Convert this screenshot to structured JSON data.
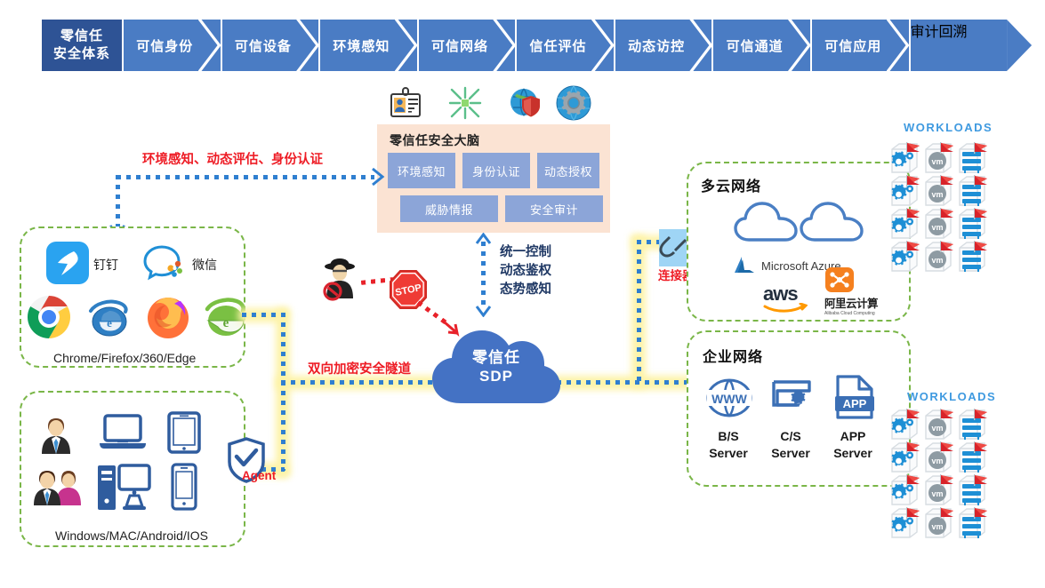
{
  "header": {
    "first_block": {
      "line1": "零信任",
      "line2": "安全体系"
    },
    "stages": [
      "可信身份",
      "可信设备",
      "环境感知",
      "可信网络",
      "信任评估",
      "动态访控",
      "可信通道",
      "可信应用",
      "审计回溯"
    ],
    "colors": {
      "first_bg": "#2e5395",
      "stage_bg": "#4a7cc4",
      "text": "#ffffff"
    }
  },
  "brain": {
    "title": "零信任安全大脑",
    "row1": [
      "环境感知",
      "身份认证",
      "动态授权"
    ],
    "row2": [
      "威胁情报",
      "安全审计"
    ],
    "panel_bg": "#fbe3d3",
    "box_bg": "#8ca5d8",
    "top_icons": [
      "id-badge-icon",
      "converge-arrows-icon",
      "globe-shield-icon",
      "globe-gear-icon"
    ]
  },
  "annotations": {
    "left_arrow_text": "环境感知、动态评估、身份认证",
    "vertical_arrow_text": [
      "统一控制",
      "动态鉴权",
      "态势感知"
    ],
    "tunnel_text": "双向加密安全隧道",
    "agent_label": "Agent",
    "connector_label": "连接器",
    "stop_sign": "STOP",
    "red": "#ee1c25",
    "blue_dot": "#2f7fd0",
    "glow": "#fdf3a8"
  },
  "clients": {
    "apps": [
      {
        "name": "dingtalk-icon",
        "label": "钉钉"
      },
      {
        "name": "wechat-icon",
        "label": "微信"
      }
    ],
    "browsers": [
      "chrome-icon",
      "ie-icon",
      "firefox-icon",
      "360-browser-icon"
    ],
    "caption": "Chrome/Firefox/360/Edge"
  },
  "devices": {
    "icons": [
      "user-single-icon",
      "laptop-icon",
      "tablet-icon",
      "user-couple-icon",
      "desktop-pc-icon",
      "smartphone-icon"
    ],
    "caption": "Windows/MAC/Android/IOS"
  },
  "multicloud": {
    "title": "多云网络",
    "clouds": [
      "cloud-outline-icon",
      "cloud-outline-icon"
    ],
    "vendors": [
      {
        "name": "azure-logo",
        "label": "Microsoft Azure"
      },
      {
        "name": "aws-logo",
        "label": "aws"
      },
      {
        "name": "aliyun-logo",
        "label": "阿里云计算",
        "sub": "Alibaba Cloud Computing"
      }
    ]
  },
  "enterprise": {
    "title": "企业网络",
    "servers": [
      {
        "icon": "www-globe-icon",
        "line1": "B/S",
        "line2": "Server"
      },
      {
        "icon": "cs-gear-icon",
        "line1": "C/S",
        "line2": "Server"
      },
      {
        "icon": "app-file-icon",
        "line1": "APP",
        "line2": "Server"
      }
    ]
  },
  "workloads": {
    "title": "WORKLOADS",
    "rows": 4,
    "cols": 3,
    "cell_types": [
      "gear-box-icon",
      "vm-box-icon",
      "rack-box-icon"
    ],
    "flag_color": "#d8232a",
    "title_color": "#3f9ae0"
  },
  "sdp": {
    "line1": "零信任",
    "line2": "SDP",
    "color": "#4472c4"
  },
  "threat": {
    "label": "STOP",
    "actor": "hacker-icon"
  }
}
